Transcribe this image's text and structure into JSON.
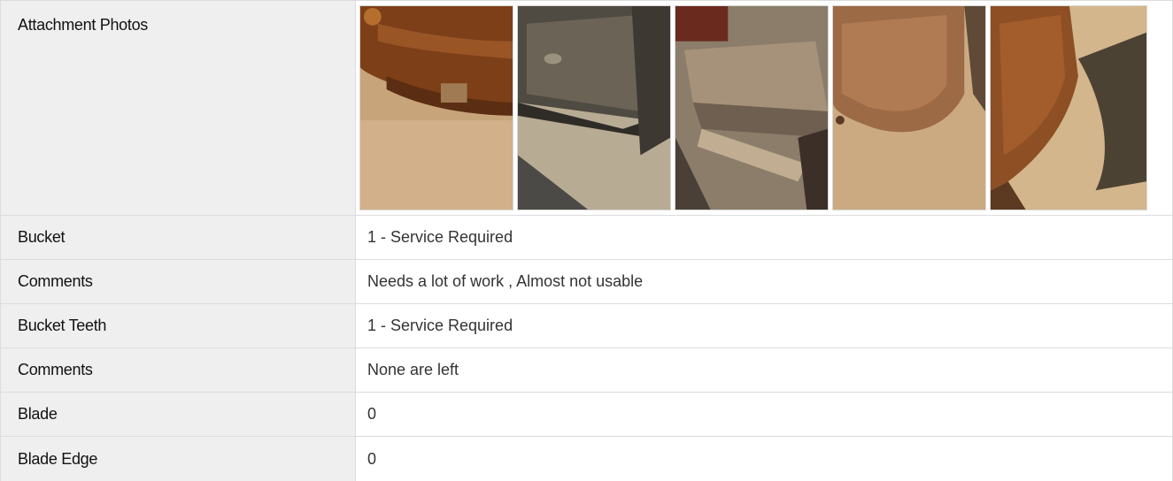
{
  "attachment_photos": {
    "label": "Attachment Photos",
    "photos": [
      {
        "icon": "rusty-bucket-photo"
      },
      {
        "icon": "bucket-interior-photo"
      },
      {
        "icon": "worn-bucket-edge-photo"
      },
      {
        "icon": "bucket-side-photo"
      },
      {
        "icon": "bucket-tip-photo"
      }
    ]
  },
  "rows": [
    {
      "label": "Bucket",
      "value": "1 - Service Required"
    },
    {
      "label": "Comments",
      "value": "Needs a lot of work , Almost not usable"
    },
    {
      "label": "Bucket Teeth",
      "value": "1 - Service Required"
    },
    {
      "label": "Comments",
      "value": "None are left"
    },
    {
      "label": "Blade",
      "value": "0"
    },
    {
      "label": "Blade Edge",
      "value": "0"
    }
  ],
  "colors": {
    "label_bg": "#efefef",
    "border": "#dcdcdc",
    "rust": "#8a4a1f",
    "sand": "#c9a57b"
  }
}
